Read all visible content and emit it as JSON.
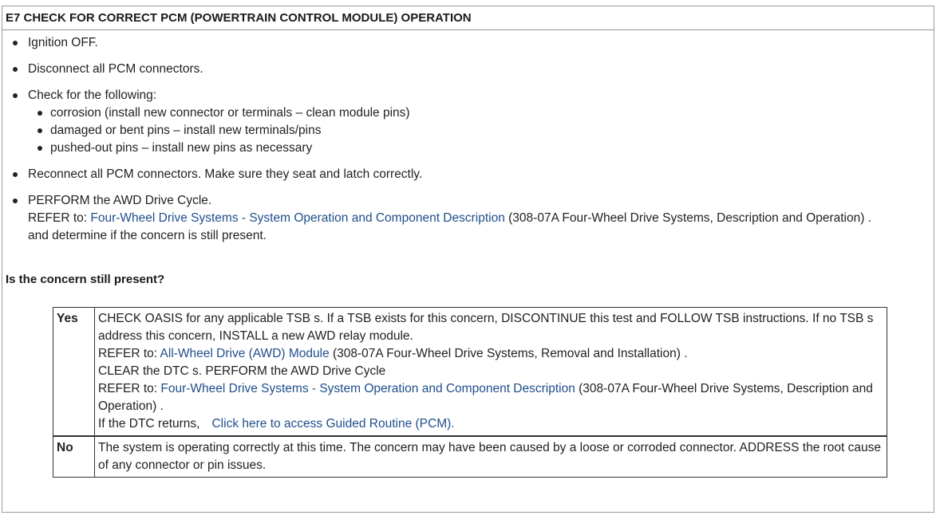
{
  "header": {
    "title": "E7 CHECK FOR CORRECT PCM (POWERTRAIN CONTROL MODULE) OPERATION"
  },
  "steps": [
    {
      "text": "Ignition OFF."
    },
    {
      "text": "Disconnect all PCM connectors."
    },
    {
      "text": "Check for the following:",
      "subitems": [
        "corrosion (install new connector or terminals – clean module pins)",
        "damaged or bent pins – install new terminals/pins",
        "pushed-out pins – install new pins as necessary"
      ]
    },
    {
      "text": "Reconnect all PCM connectors. Make sure they seat and latch correctly."
    },
    {
      "text": "PERFORM the AWD Drive Cycle.",
      "refer_prefix": "REFER to: ",
      "refer_link": "Four-Wheel Drive Systems - System Operation and Component Description",
      "refer_suffix": " (308-07A Four-Wheel Drive Systems, Description and Operation) .",
      "followup": "and determine if the concern is still present."
    }
  ],
  "question": "Is the concern still present?",
  "answers": {
    "yes": {
      "label": "Yes",
      "line1": "CHECK OASIS for any applicable TSB s. If a TSB exists for this concern, DISCONTINUE this test and FOLLOW TSB instructions. If no TSB s address this concern, INSTALL a new AWD relay module.",
      "refer1_prefix": "REFER to: ",
      "refer1_link": "All-Wheel Drive (AWD) Module",
      "refer1_suffix": " (308-07A Four-Wheel Drive Systems, Removal and Installation) .",
      "line2": "CLEAR the DTC s. PERFORM the AWD Drive Cycle",
      "refer2_prefix": "REFER to: ",
      "refer2_link": "Four-Wheel Drive Systems - System Operation and Component Description",
      "refer2_suffix": " (308-07A Four-Wheel Drive Systems, Description and Operation) .",
      "dtc_prefix": "If the DTC returns,",
      "guided_link": "Click here to access Guided Routine (PCM)."
    },
    "no": {
      "label": "No",
      "text": "The system is operating correctly at this time. The concern may have been caused by a loose or corroded connector. ADDRESS the root cause of any connector or pin issues."
    }
  },
  "colors": {
    "link": "#1f4e8c",
    "text": "#222222",
    "border": "#333333"
  }
}
